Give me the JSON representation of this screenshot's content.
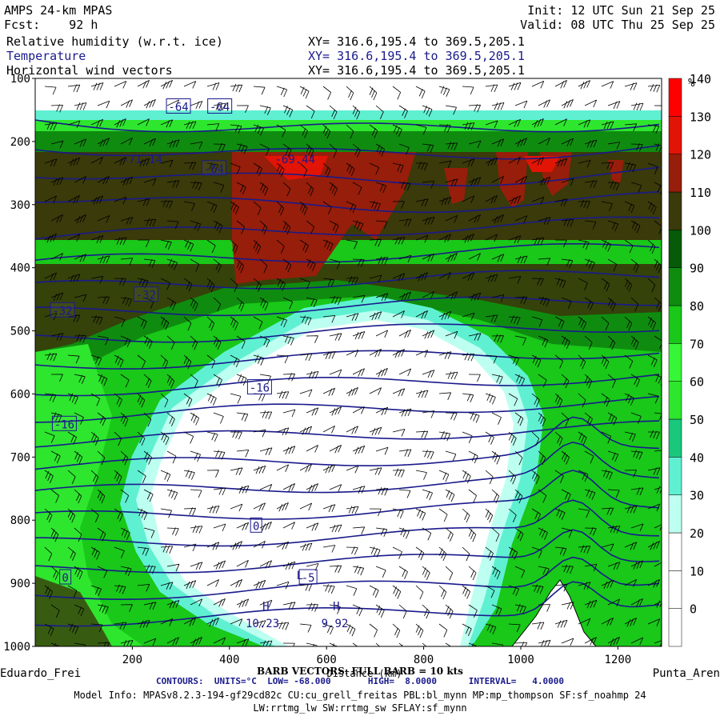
{
  "header": {
    "model": "AMPS 24-km MPAS",
    "fcst_label": "Fcst:",
    "fcst_value": "92 h",
    "init": "Init: 12 UTC Sun 21 Sep 25",
    "valid": "Valid: 08 UTC Thu 25 Sep 25",
    "fields": [
      {
        "name": "Relative humidity (w.r.t. ice)",
        "xy": "XY= 316.6,195.4 to 369.5,205.1"
      },
      {
        "name": "Temperature",
        "xy": "XY= 316.6,195.4 to 369.5,205.1"
      },
      {
        "name": "Horizontal wind vectors",
        "xy": "XY= 316.6,195.4 to 369.5,205.1"
      }
    ]
  },
  "footer": {
    "barb": "BARB VECTORS: FULL BARB = 10 kts",
    "xlabel": "Distance (km)",
    "contours": "CONTOURS:  UNITS=°C  LOW= -68.000       HIGH=  8.0000      INTERVAL=   4.0000",
    "model_info_1": "Model Info: MPASv8.2.3-194-gf29cd82c CU:cu_grell_freitas PBL:bl_mynn MP:mp_thompson SF:sf_noahmp 24",
    "model_info_2": "LW:rrtmg_lw SW:rrtmg_sw SFLAY:sf_mynn"
  },
  "chart_data": {
    "type": "heatmap",
    "title": "Relative humidity (w.r.t. ice)",
    "x_unit": "km",
    "y_unit": "hPa",
    "xlim": [
      0,
      1290
    ],
    "ylim": [
      1000,
      100
    ],
    "x_ticks": [
      200,
      400,
      600,
      800,
      1000,
      1200
    ],
    "y_ticks": [
      100,
      200,
      300,
      400,
      500,
      600,
      700,
      800,
      900,
      1000
    ],
    "x_end_labels": {
      "left": "Eduardo_Frei",
      "right": "Punta_Aren"
    },
    "colorbar": {
      "unit": "%",
      "bounds": [
        0,
        10,
        20,
        30,
        40,
        50,
        60,
        70,
        80,
        90,
        100,
        110,
        120,
        130,
        140,
        150
      ],
      "labels": [
        140,
        130,
        120,
        110,
        100,
        90,
        80,
        70,
        60,
        50,
        40,
        30,
        20,
        10,
        0
      ],
      "colors": [
        "#ffffff",
        "#ffffff",
        "#ffffff",
        "#bdfff0",
        "#5ff0d2",
        "#19c87d",
        "#2ee62e",
        "#37f537",
        "#19c819",
        "#0f8c0f",
        "#075a07",
        "#3a3a0a",
        "#961e0a",
        "#e11405",
        "#ff0000"
      ]
    },
    "temperature_contours": {
      "units": "°C",
      "low": -68.0,
      "high": 8.0,
      "interval": 4.0,
      "labels": [
        {
          "text": "-64",
          "x": 295,
          "p": 145
        },
        {
          "text": "-64",
          "x": 380,
          "p": 145
        },
        {
          "text": "-64",
          "x": 368,
          "p": 243
        },
        {
          "text": "-71.14",
          "x": 220,
          "p": 228
        },
        {
          "text": "-69.44",
          "x": 535,
          "p": 228
        },
        {
          "text": "-32",
          "x": 56,
          "p": 468
        },
        {
          "text": "-32",
          "x": 228,
          "p": 443
        },
        {
          "text": "-16",
          "x": 462,
          "p": 590
        },
        {
          "text": "-16",
          "x": 60,
          "p": 648
        },
        {
          "text": "0",
          "x": 455,
          "p": 809
        },
        {
          "text": "0",
          "x": 62,
          "p": 891
        },
        {
          "text": "L",
          "x": 545,
          "p": 887
        },
        {
          "text": "-5",
          "x": 562,
          "p": 891
        },
        {
          "text": "H",
          "x": 475,
          "p": 936
        },
        {
          "text": "10.23",
          "x": 468,
          "p": 963
        },
        {
          "text": "H",
          "x": 620,
          "p": 936
        },
        {
          "text": "9.92",
          "x": 617,
          "p": 963
        }
      ]
    }
  }
}
